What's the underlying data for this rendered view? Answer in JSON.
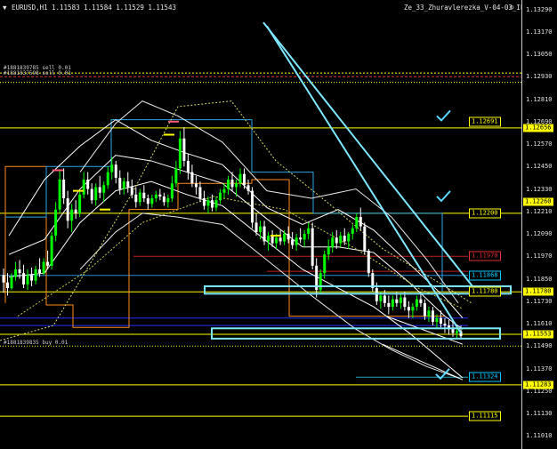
{
  "header": {
    "menu_glyph": "▼",
    "symbol": "EURUSD,H1",
    "ohlc": "1.11583 1.11584 1.11529 1.11543",
    "indicator": "Ze_33_Zhuravlerezka_V-04-03_Ibush",
    "indicator_glyph": "☺"
  },
  "axis_ticks": [
    "1.13290",
    "1.13170",
    "1.13050",
    "1.12930",
    "1.12810",
    "1.12690",
    "1.12570",
    "1.12450",
    "1.12330",
    "1.12210",
    "1.12090",
    "1.11970",
    "1.11850",
    "1.11730",
    "1.11610",
    "1.11490",
    "1.11370",
    "1.11250",
    "1.11130",
    "1.11010"
  ],
  "price_axis": {
    "min": 1.1094,
    "max": 1.1334
  },
  "level_tags": [
    {
      "text": "1.12691",
      "price": 1.12691,
      "color": "#ffff00"
    },
    {
      "text": "1.12200",
      "price": 1.122,
      "color": "#ffff00"
    },
    {
      "text": "1.11970",
      "price": 1.1197,
      "color": "#e03030"
    },
    {
      "text": "1.11868",
      "price": 1.11868,
      "color": "#00c8ff"
    },
    {
      "text": "1.11780",
      "price": 1.1178,
      "color": "#ffff00"
    },
    {
      "text": "1.11324",
      "price": 1.11324,
      "color": "#00c8ff"
    },
    {
      "text": "1.11115",
      "price": 1.11115,
      "color": "#ffff00"
    }
  ],
  "axis_tags": [
    {
      "text": "1.12656",
      "price": 1.12656,
      "bg": "#ffff00",
      "fg": "#000000"
    },
    {
      "text": "1.12260",
      "price": 1.1226,
      "bg": "#ffff00",
      "fg": "#000000"
    },
    {
      "text": "1.11780",
      "price": 1.1178,
      "bg": "#ffff00",
      "fg": "#000000"
    },
    {
      "text": "1.11553",
      "price": 1.11553,
      "bg": "#ffff00",
      "fg": "#000000"
    },
    {
      "text": "1.11283",
      "price": 1.11283,
      "bg": "#ffff00",
      "fg": "#000000"
    }
  ],
  "order_notes": [
    {
      "text": "#1881839785 sell 0.01",
      "price": 1.1296
    },
    {
      "text": "#1881837598 sell 0.01",
      "price": 1.1293
    },
    {
      "text": "#1881839835 buy 0.01",
      "price": 1.1149
    }
  ],
  "colors": {
    "background": "#000000",
    "bull": "#00ff00",
    "bear": "#ffffff",
    "level": "#ffff00",
    "trend": "#7ee8ff"
  },
  "candles": [
    [
      1.1187,
      1.11905,
      1.11775,
      1.1183
    ],
    [
      1.1183,
      1.1188,
      1.1176,
      1.118
    ],
    [
      1.118,
      1.1188,
      1.1179,
      1.1186
    ],
    [
      1.1186,
      1.1194,
      1.1184,
      1.119
    ],
    [
      1.119,
      1.1195,
      1.1185,
      1.1188
    ],
    [
      1.1188,
      1.11925,
      1.118,
      1.1182
    ],
    [
      1.1182,
      1.119,
      1.1179,
      1.1187
    ],
    [
      1.1187,
      1.1191,
      1.1181,
      1.1184
    ],
    [
      1.1184,
      1.1192,
      1.1182,
      1.119
    ],
    [
      1.119,
      1.1196,
      1.1186,
      1.1188
    ],
    [
      1.1188,
      1.1196,
      1.1187,
      1.1194
    ],
    [
      1.1194,
      1.12,
      1.119,
      1.1192
    ],
    [
      1.1192,
      1.121,
      1.119,
      1.1208
    ],
    [
      1.1208,
      1.1226,
      1.1205,
      1.1222
    ],
    [
      1.1222,
      1.1243,
      1.122,
      1.1238
    ],
    [
      1.1238,
      1.1244,
      1.1225,
      1.1228
    ],
    [
      1.1228,
      1.1232,
      1.1212,
      1.1216
    ],
    [
      1.1216,
      1.1225,
      1.121,
      1.1222
    ],
    [
      1.1222,
      1.1227,
      1.1217,
      1.122
    ],
    [
      1.122,
      1.1232,
      1.1218,
      1.123
    ],
    [
      1.123,
      1.1242,
      1.1228,
      1.1238
    ],
    [
      1.1238,
      1.1242,
      1.123,
      1.1233
    ],
    [
      1.1233,
      1.1236,
      1.1225,
      1.1227
    ],
    [
      1.1227,
      1.1236,
      1.1224,
      1.1234
    ],
    [
      1.1234,
      1.124,
      1.1228,
      1.1231
    ],
    [
      1.1231,
      1.1237,
      1.1226,
      1.1235
    ],
    [
      1.1235,
      1.1245,
      1.1233,
      1.1242
    ],
    [
      1.1242,
      1.125,
      1.1238,
      1.1246
    ],
    [
      1.1246,
      1.1248,
      1.1236,
      1.1239
    ],
    [
      1.1239,
      1.1243,
      1.123,
      1.1233
    ],
    [
      1.1233,
      1.1239,
      1.123,
      1.1237
    ],
    [
      1.1237,
      1.1242,
      1.1231,
      1.1234
    ],
    [
      1.1234,
      1.1238,
      1.1228,
      1.123
    ],
    [
      1.123,
      1.1234,
      1.1223,
      1.1226
    ],
    [
      1.1226,
      1.1233,
      1.1224,
      1.1231
    ],
    [
      1.1231,
      1.1235,
      1.1226,
      1.1228
    ],
    [
      1.1228,
      1.123,
      1.1222,
      1.1225
    ],
    [
      1.1225,
      1.123,
      1.1223,
      1.1228
    ],
    [
      1.1228,
      1.1232,
      1.1226,
      1.123
    ],
    [
      1.123,
      1.1233,
      1.1227,
      1.1229
    ],
    [
      1.1229,
      1.1231,
      1.1224,
      1.1226
    ],
    [
      1.1226,
      1.123,
      1.1223,
      1.1228
    ],
    [
      1.1228,
      1.124,
      1.1226,
      1.1236
    ],
    [
      1.1236,
      1.1248,
      1.1234,
      1.1244
    ],
    [
      1.1244,
      1.1264,
      1.1241,
      1.126
    ],
    [
      1.126,
      1.1266,
      1.1245,
      1.1248
    ],
    [
      1.1248,
      1.1252,
      1.1238,
      1.1242
    ],
    [
      1.1242,
      1.1246,
      1.1234,
      1.1236
    ],
    [
      1.1236,
      1.124,
      1.123,
      1.1234
    ],
    [
      1.1234,
      1.1237,
      1.1226,
      1.1228
    ],
    [
      1.1228,
      1.1232,
      1.1222,
      1.1224
    ],
    [
      1.1224,
      1.1229,
      1.122,
      1.1227
    ],
    [
      1.1227,
      1.123,
      1.1221,
      1.1223
    ],
    [
      1.1223,
      1.1229,
      1.1221,
      1.1227
    ],
    [
      1.1227,
      1.1233,
      1.1225,
      1.1231
    ],
    [
      1.1231,
      1.1236,
      1.1228,
      1.1233
    ],
    [
      1.1233,
      1.124,
      1.123,
      1.1238
    ],
    [
      1.1238,
      1.1242,
      1.1232,
      1.1234
    ],
    [
      1.1234,
      1.1238,
      1.1229,
      1.1236
    ],
    [
      1.1236,
      1.1244,
      1.1234,
      1.1241
    ],
    [
      1.1241,
      1.1244,
      1.1233,
      1.1235
    ],
    [
      1.1235,
      1.1238,
      1.123,
      1.1232
    ],
    [
      1.1232,
      1.1234,
      1.1212,
      1.1215
    ],
    [
      1.1215,
      1.122,
      1.1208,
      1.121
    ],
    [
      1.121,
      1.1216,
      1.1206,
      1.1213
    ],
    [
      1.1213,
      1.1216,
      1.1203,
      1.1205
    ],
    [
      1.1205,
      1.121,
      1.12,
      1.1208
    ],
    [
      1.1208,
      1.1211,
      1.1202,
      1.1204
    ],
    [
      1.1204,
      1.1209,
      1.1201,
      1.1207
    ],
    [
      1.1207,
      1.1211,
      1.1203,
      1.1205
    ],
    [
      1.1205,
      1.1211,
      1.1203,
      1.1209
    ],
    [
      1.1209,
      1.1213,
      1.1204,
      1.1206
    ],
    [
      1.1206,
      1.121,
      1.1201,
      1.1203
    ],
    [
      1.1203,
      1.1209,
      1.12,
      1.1207
    ],
    [
      1.1207,
      1.1212,
      1.1204,
      1.1206
    ],
    [
      1.1206,
      1.1211,
      1.1202,
      1.1209
    ],
    [
      1.1209,
      1.1215,
      1.1206,
      1.1212
    ],
    [
      1.1212,
      1.1215,
      1.119,
      1.1192
    ],
    [
      1.1192,
      1.1196,
      1.1175,
      1.1179
    ],
    [
      1.1179,
      1.119,
      1.1177,
      1.1188
    ],
    [
      1.1188,
      1.12,
      1.1185,
      1.1198
    ],
    [
      1.1198,
      1.1206,
      1.1195,
      1.1202
    ],
    [
      1.1202,
      1.121,
      1.1199,
      1.1207
    ],
    [
      1.1207,
      1.1211,
      1.1201,
      1.1204
    ],
    [
      1.1204,
      1.121,
      1.1202,
      1.1208
    ],
    [
      1.1208,
      1.1212,
      1.1203,
      1.1205
    ],
    [
      1.1205,
      1.121,
      1.1201,
      1.1209
    ],
    [
      1.1209,
      1.1214,
      1.1206,
      1.1212
    ],
    [
      1.1212,
      1.122,
      1.121,
      1.1218
    ],
    [
      1.1218,
      1.1223,
      1.1211,
      1.1213
    ],
    [
      1.1213,
      1.1215,
      1.1198,
      1.12
    ],
    [
      1.12,
      1.1201,
      1.1186,
      1.1188
    ],
    [
      1.1188,
      1.119,
      1.1178,
      1.118
    ],
    [
      1.118,
      1.1183,
      1.1171,
      1.1173
    ],
    [
      1.1173,
      1.1178,
      1.1169,
      1.1176
    ],
    [
      1.1176,
      1.1179,
      1.117,
      1.1172
    ],
    [
      1.1172,
      1.1176,
      1.1166,
      1.117
    ],
    [
      1.117,
      1.1176,
      1.1168,
      1.1174
    ],
    [
      1.1174,
      1.1178,
      1.117,
      1.1172
    ],
    [
      1.1172,
      1.1177,
      1.1169,
      1.1175
    ],
    [
      1.1175,
      1.1178,
      1.1168,
      1.117
    ],
    [
      1.117,
      1.1173,
      1.1164,
      1.1168
    ],
    [
      1.1168,
      1.1172,
      1.1164,
      1.117
    ],
    [
      1.117,
      1.1176,
      1.1168,
      1.1174
    ],
    [
      1.1174,
      1.1178,
      1.117,
      1.1172
    ],
    [
      1.1172,
      1.1174,
      1.1163,
      1.1165
    ],
    [
      1.1165,
      1.117,
      1.1162,
      1.1168
    ],
    [
      1.1168,
      1.117,
      1.116,
      1.1162
    ],
    [
      1.1162,
      1.1166,
      1.1158,
      1.1164
    ],
    [
      1.1164,
      1.1168,
      1.1159,
      1.1161
    ],
    [
      1.1161,
      1.1164,
      1.1156,
      1.116
    ],
    [
      1.116,
      1.1163,
      1.1155,
      1.1158
    ],
    [
      1.1158,
      1.1162,
      1.1154,
      1.1156
    ],
    [
      1.1156,
      1.116,
      1.1153,
      1.1157
    ],
    [
      1.1157,
      1.116,
      1.1153,
      1.11543
    ]
  ]
}
